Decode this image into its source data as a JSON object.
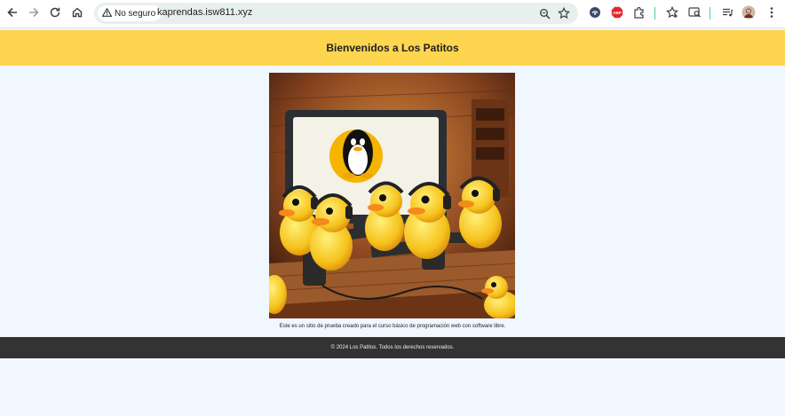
{
  "browser": {
    "security_label": "No seguro",
    "url": "kaprendas.isw811.xyz",
    "icons": [
      "back-icon",
      "forward-icon",
      "reload-icon",
      "home-icon",
      "warning-icon",
      "zoom-icon",
      "star-icon",
      "extension-icon",
      "adblock-icon",
      "puzzle-icon",
      "bookmark-icon",
      "search-panel-icon",
      "reading-list-icon",
      "avatar",
      "menu-icon"
    ],
    "adblock_badge": "ABP"
  },
  "page": {
    "title": "Bienvenidos a Los Patitos",
    "description": "Este es un sitio de prueba creado para el curso básico de programación web con software libre.",
    "footer": "© 2024 Los Patitos. Todos los derechos reservados.",
    "header_color": "#fed54f",
    "footer_color": "#333333",
    "background_color": "#f0f7ff"
  }
}
